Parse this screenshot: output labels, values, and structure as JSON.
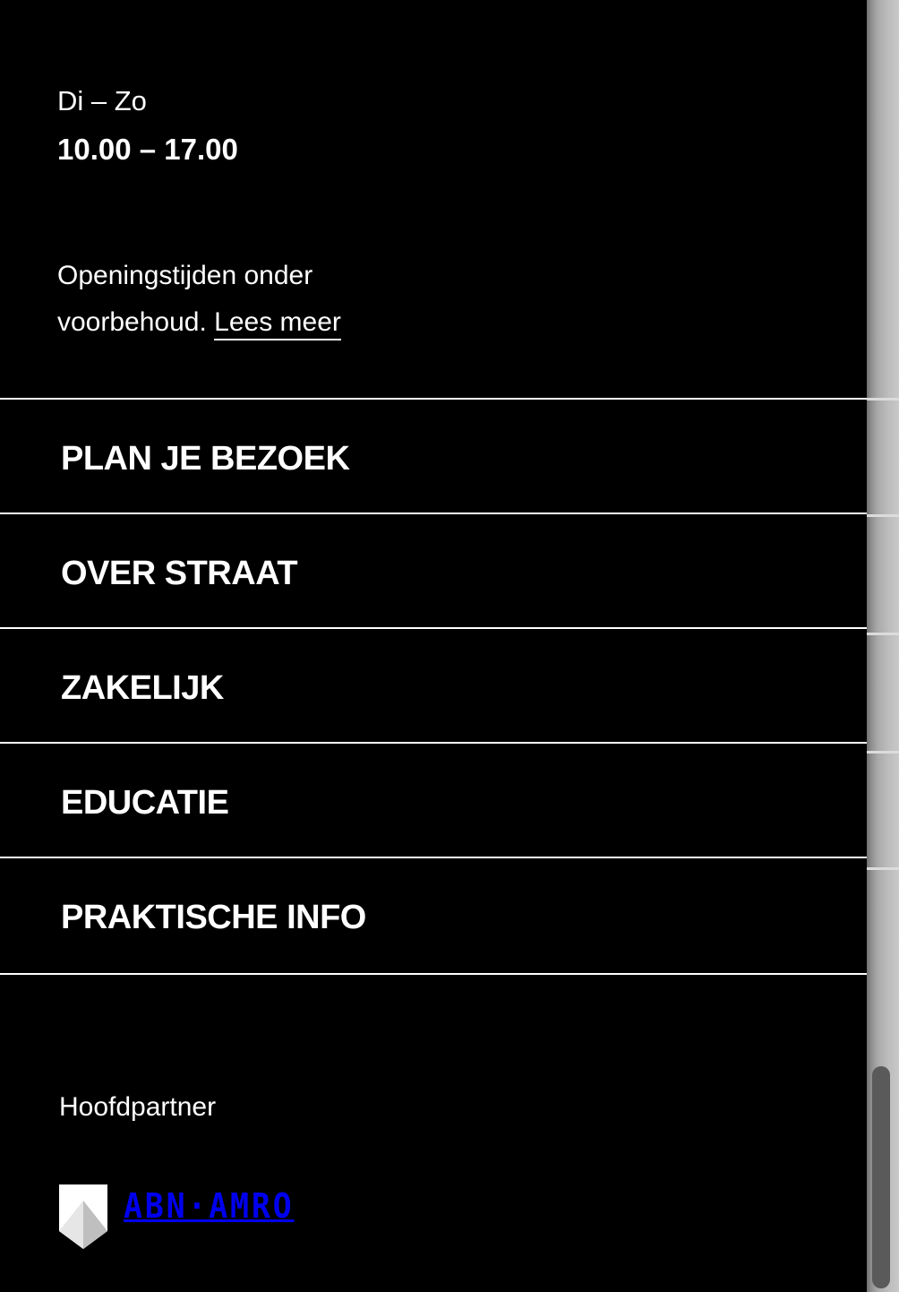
{
  "hours": {
    "days": "Di – Zo",
    "time": "10.00 – 17.00"
  },
  "notice": {
    "text_before": "Openingstijden onder voorbehoud.",
    "link_label": "Lees meer"
  },
  "nav": {
    "items": [
      {
        "label": "PLAN JE BEZOEK"
      },
      {
        "label": "OVER STRAAT"
      },
      {
        "label": "ZAKELIJK"
      },
      {
        "label": "EDUCATIE"
      },
      {
        "label": "PRAKTISCHE INFO"
      }
    ]
  },
  "partner": {
    "label": "Hoofdpartner",
    "logo_text": "ABN·AMRO",
    "logo_icon": "abn-amro-shield-logo"
  },
  "colors": {
    "background": "#000000",
    "text": "#ffffff",
    "divider": "#ffffff"
  }
}
